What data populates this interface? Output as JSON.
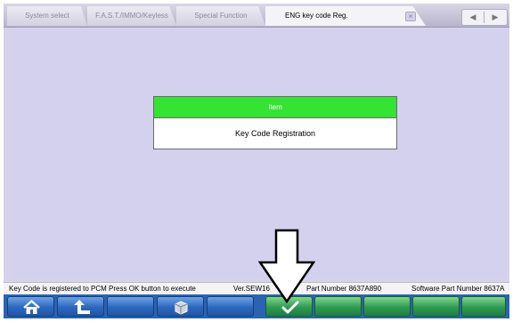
{
  "tabs": [
    {
      "label": "System select",
      "active": false
    },
    {
      "label": "F.A.S.T./IMMO/Keyless",
      "active": false
    },
    {
      "label": "Special Function",
      "active": false
    },
    {
      "label": "ENG key code Reg.",
      "active": true
    }
  ],
  "table": {
    "header": "Item",
    "rows": [
      "Key Code Registration"
    ]
  },
  "status": {
    "message": "Key Code is registered to PCM Press OK button to execute",
    "version": "Ver.SEW16",
    "part_number": "Part Number 8637A890",
    "software_part_number": "Software Part Number 8637A"
  },
  "toolbar": {
    "buttons": [
      "home-icon",
      "back-arrow-icon",
      "",
      "package-icon",
      "",
      "ok-check-icon",
      "",
      "",
      "",
      ""
    ]
  },
  "colors": {
    "header_green": "#33e433",
    "toolbar_blue": "#2a63b4",
    "content_bg": "#d3d1ee",
    "ok_green": "#2f9a53"
  }
}
